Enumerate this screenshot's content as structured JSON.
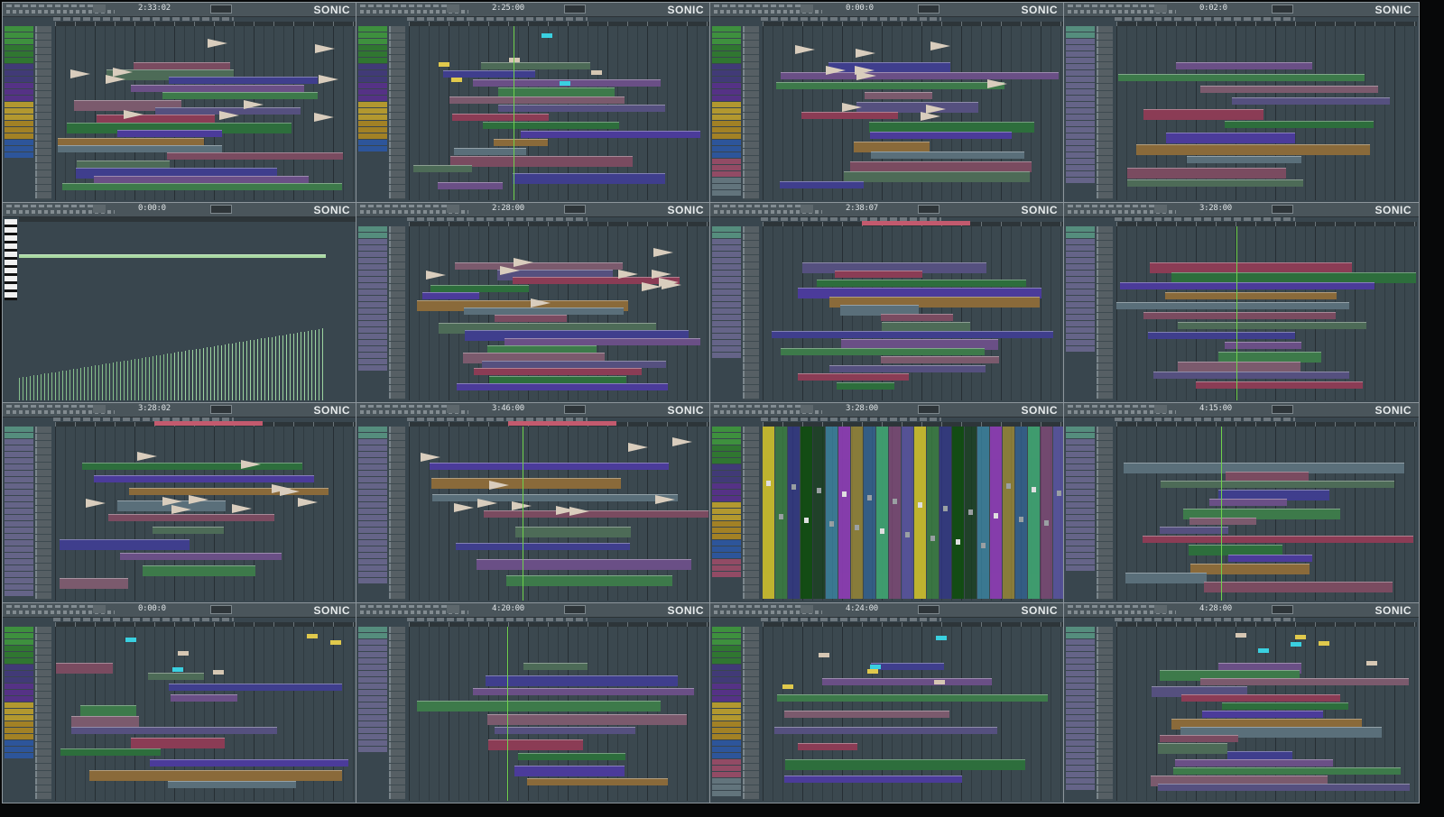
{
  "app": {
    "logo": "SONIC",
    "accent": "#6fd24c",
    "selection_color": "#c35a6e"
  },
  "tiles": [
    {
      "time": "2:33:02",
      "view": "playlist",
      "style": 0
    },
    {
      "time": "2:25:00",
      "view": "playlist",
      "style": 1
    },
    {
      "time": "0:00:0",
      "view": "playlist",
      "style": 2
    },
    {
      "time": "0:02:0",
      "view": "playlist",
      "style": 3
    },
    {
      "time": "0:00:0",
      "view": "piano-roll",
      "style": 4
    },
    {
      "time": "2:28:00",
      "view": "playlist",
      "style": 5
    },
    {
      "time": "2:38:07",
      "view": "playlist",
      "style": 6
    },
    {
      "time": "3:28:00",
      "view": "playlist",
      "style": 7
    },
    {
      "time": "3:28:02",
      "view": "playlist",
      "style": 8
    },
    {
      "time": "3:46:00",
      "view": "playlist",
      "style": 9
    },
    {
      "time": "3:28:00",
      "view": "mixer",
      "style": 10
    },
    {
      "time": "4:15:00",
      "view": "playlist",
      "style": 11
    },
    {
      "time": "0:00:0",
      "view": "playlist",
      "style": 12
    },
    {
      "time": "4:20:00",
      "view": "playlist",
      "style": 13
    },
    {
      "time": "4:24:00",
      "view": "playlist",
      "style": 14
    },
    {
      "time": "4:28:00",
      "view": "playlist",
      "style": 15
    }
  ]
}
